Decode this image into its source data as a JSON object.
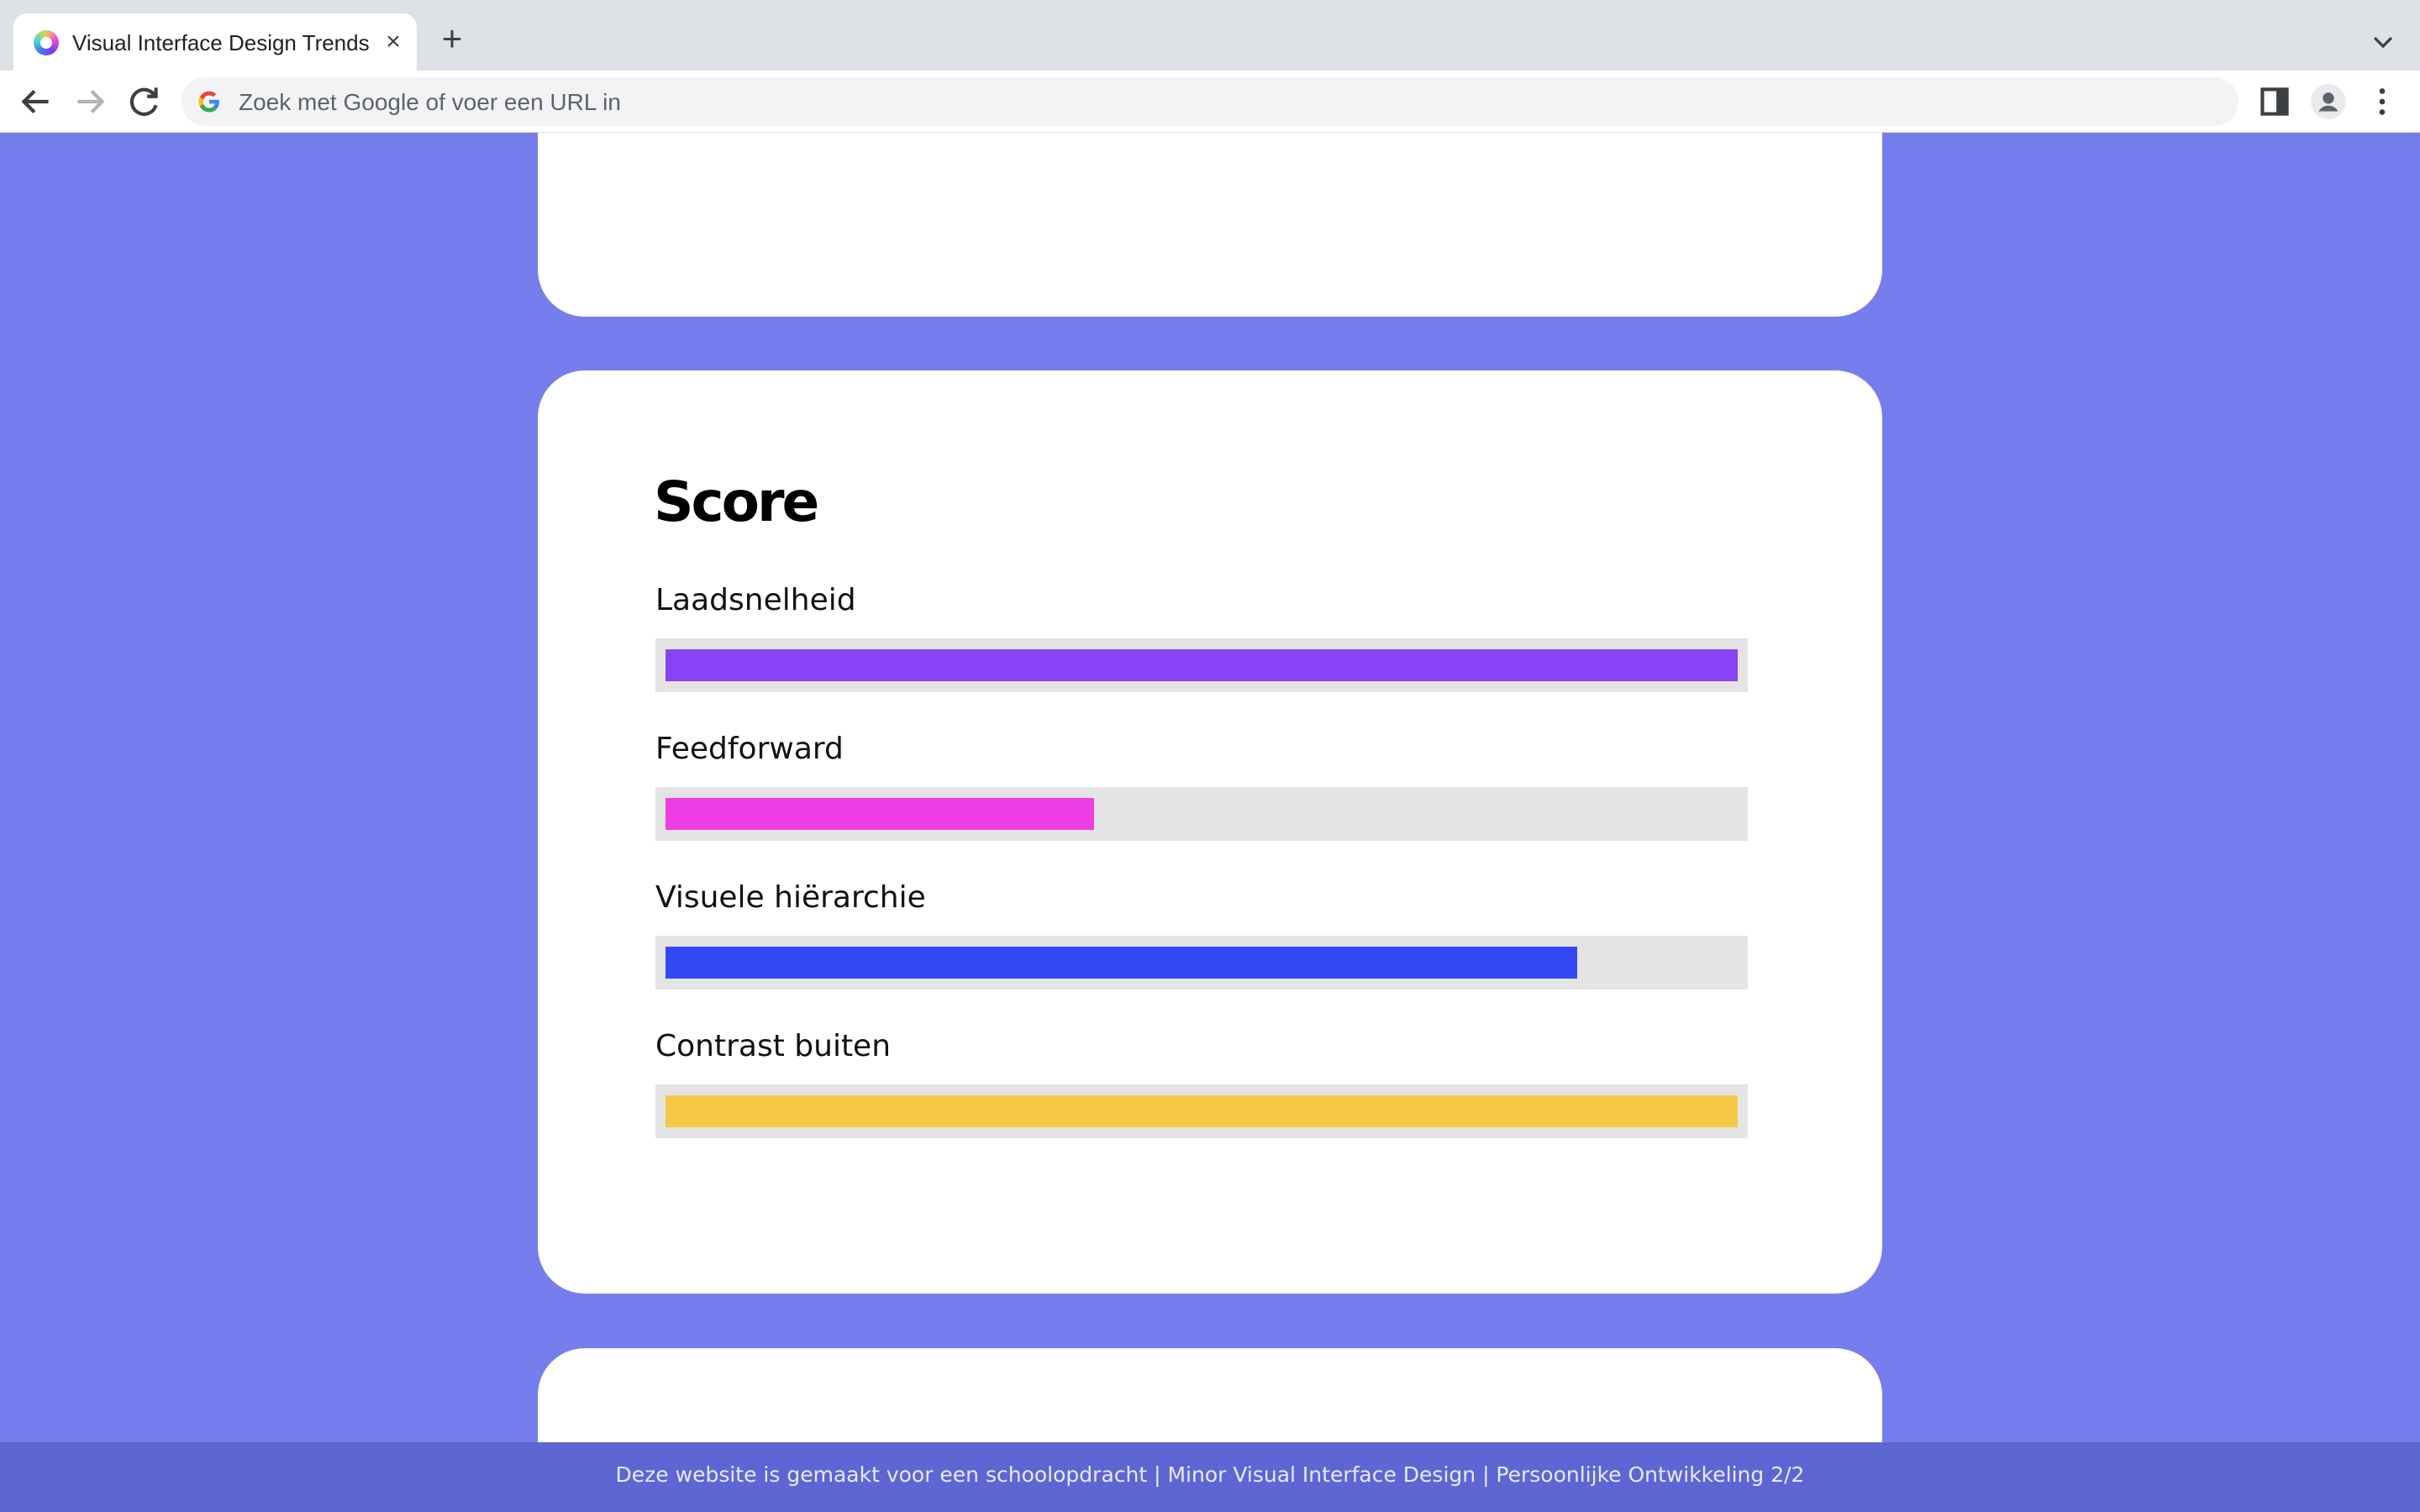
{
  "browser": {
    "tab_title": "Visual Interface Design Trends",
    "tab_close": "×",
    "new_tab": "+",
    "omnibox_placeholder": "Zoek met Google of voer een URL in"
  },
  "score": {
    "title": "Score",
    "metrics": [
      {
        "label": "Laadsnelheid",
        "level": 1.0,
        "color": "#8942f5"
      },
      {
        "label": "Feedforward",
        "level": 0.4,
        "color": "#ed3ee6"
      },
      {
        "label": "Visuele hiërarchie",
        "level": 0.85,
        "color": "#3548f5"
      },
      {
        "label": "Contrast buiten",
        "level": 1.0,
        "color": "#f5c945"
      }
    ]
  },
  "footer": {
    "text": "Deze website is gemaakt voor een schoolopdracht | Minor Visual Interface Design | Persoonlijke Ontwikkeling 2/2"
  },
  "colors": {
    "page_background": "#767ded",
    "footer_background": "#5d66d3",
    "card_background": "#ffffff",
    "track_background": "#e4e4e4"
  },
  "icons": [
    "favicon-ring-icon",
    "close-icon",
    "plus-icon",
    "chevron-down-icon",
    "back-arrow-icon",
    "forward-arrow-icon",
    "reload-icon",
    "google-g-icon",
    "side-panel-icon",
    "profile-icon",
    "more-vert-icon"
  ]
}
